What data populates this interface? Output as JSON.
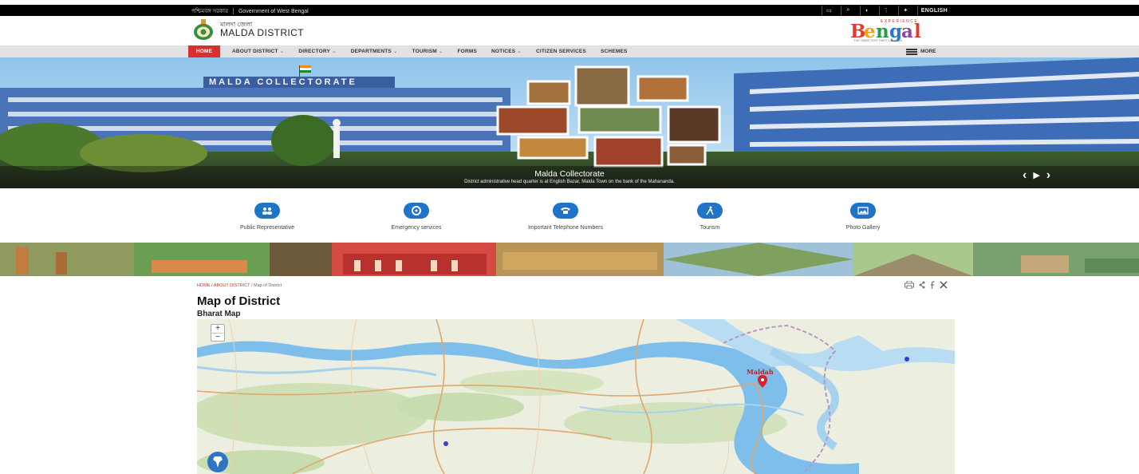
{
  "topbar": {
    "gov_bengali": "পশ্চিমবঙ্গ সরকার",
    "gov_english": "Government of West Bengal",
    "tools": [
      {
        "icon": "skip-to-content-icon",
        "label": "▭"
      },
      {
        "icon": "search-icon",
        "label": "⌕"
      },
      {
        "icon": "accessibility-icon",
        "label": "◐"
      },
      {
        "icon": "sitemap-icon",
        "label": "⋮"
      },
      {
        "icon": "accessibility-person-icon",
        "label": "✦"
      }
    ],
    "language": "ENGLISH"
  },
  "header": {
    "brand_sub": "মালদা জেলা",
    "brand_title": "MALDA DISTRICT",
    "bengal_logo": {
      "experience": "EXPERIENCE",
      "word": "Bengal",
      "tag": "THE SWEETEST PART OF INDIA"
    }
  },
  "nav": {
    "items": [
      {
        "label": "HOME",
        "dropdown": false,
        "active": true
      },
      {
        "label": "ABOUT DISTRICT",
        "dropdown": true
      },
      {
        "label": "DIRECTORY",
        "dropdown": true
      },
      {
        "label": "DEPARTMENTS",
        "dropdown": true
      },
      {
        "label": "TOURISM",
        "dropdown": true
      },
      {
        "label": "FORMS",
        "dropdown": false
      },
      {
        "label": "NOTICES",
        "dropdown": true
      },
      {
        "label": "CITIZEN SERVICES",
        "dropdown": false
      },
      {
        "label": "SCHEMES",
        "dropdown": false
      }
    ],
    "more": "MORE"
  },
  "slider": {
    "banner_text": "MALDA COLLECTORATE",
    "caption_title": "Malda Collectorate",
    "caption_sub": "District administrative head quarter is at English Bazar, Malda Town on the bank of the Mahananda.",
    "controls": {
      "prev": "‹",
      "pause": "▶",
      "next": "›"
    }
  },
  "quick_links": [
    {
      "label": "Public Representative",
      "icon": "people-icon",
      "glyph": "👥"
    },
    {
      "label": "Emergency services",
      "icon": "lifebuoy-icon",
      "glyph": "◎"
    },
    {
      "label": "Important Telephone Numbers",
      "icon": "phone-icon",
      "glyph": "☎"
    },
    {
      "label": "Tourism",
      "icon": "traveller-icon",
      "glyph": "✈"
    },
    {
      "label": "Photo Gallery",
      "icon": "gallery-icon",
      "glyph": "▣"
    }
  ],
  "breadcrumb": {
    "home": "HOME",
    "about": "ABOUT DISTRICT",
    "current": "Map of District"
  },
  "share": {
    "print": "print-icon",
    "share": "share-icon",
    "facebook": "facebook-icon",
    "x": "x-icon"
  },
  "page": {
    "title": "Map of District",
    "map_title": "Bharat Map"
  },
  "map": {
    "zoom_in": "+",
    "zoom_out": "−",
    "marker_label": "Maldah",
    "colors": {
      "land": "#eceee0",
      "water": "#6cb6e8",
      "forest": "#c7dcaf",
      "road": "#e2a56b"
    }
  },
  "colors": {
    "nav_active": "#d9302d",
    "quick_icon": "#1e74c6",
    "topbar": "#000000"
  }
}
